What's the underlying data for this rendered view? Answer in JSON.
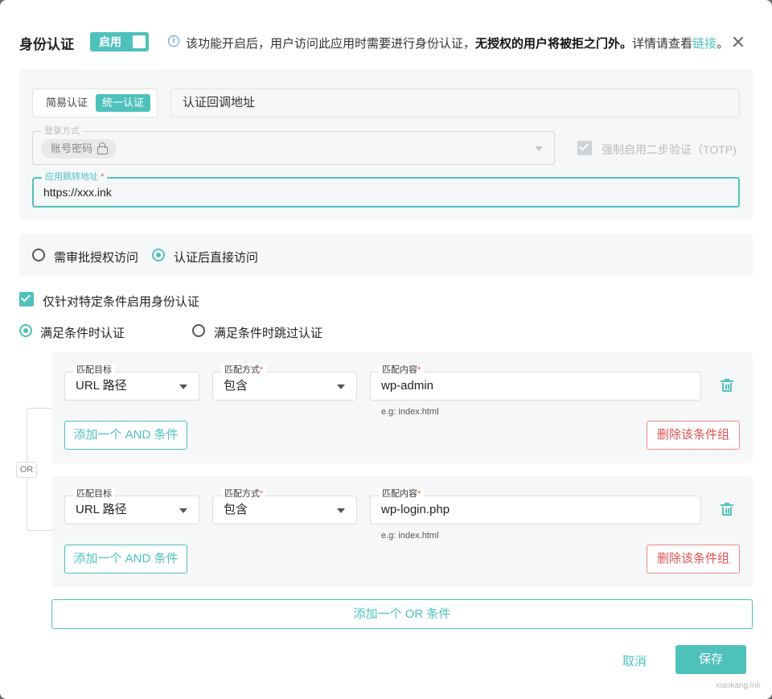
{
  "header": {
    "title": "身份认证",
    "toggle_label": "启用",
    "info_text": "该功能开启后，用户访问此应用时需要进行身份认证，",
    "info_bold": "无授权的用户将被拒之门外。",
    "info_suffix": "详情请查看",
    "info_link": "链接",
    "info_end": "。"
  },
  "auth_panel": {
    "mode_tabs": [
      {
        "label": "简易认证",
        "active": false
      },
      {
        "label": "统一认证",
        "active": true
      }
    ],
    "callback_url_label": "认证回调地址",
    "login_method_legend": "登录方式",
    "login_method_chip": "账号密码",
    "totp_label": "强制启用二步验证（TOTP)",
    "totp_checked": true,
    "redirect_legend": "应用跳转地址",
    "redirect_required": "*",
    "redirect_value": "https://xxx.ink"
  },
  "access": {
    "options": [
      "需审批授权访问",
      "认证后直接访问"
    ],
    "selected": "认证后直接访问"
  },
  "condition": {
    "checkbox_label": "仅针对特定条件启用身份认证",
    "checked": true,
    "modes": [
      "满足条件时认证",
      "满足条件时跳过认证"
    ],
    "selected_mode": "满足条件时认证",
    "or_label": "OR",
    "groups": [
      {
        "target_legend": "匹配目标",
        "target_value": "URL 路径",
        "method_legend": "匹配方式",
        "method_value": "包含",
        "content_legend": "匹配内容",
        "content_value": "wp-admin",
        "hint": "e.g: index.html",
        "add_and_label": "添加一个 AND 条件",
        "delete_group_label": "删除该条件组"
      },
      {
        "target_legend": "匹配目标",
        "target_value": "URL 路径",
        "method_legend": "匹配方式",
        "method_value": "包含",
        "content_legend": "匹配内容",
        "content_value": "wp-login.php",
        "hint": "e.g: index.html",
        "add_and_label": "添加一个 AND 条件",
        "delete_group_label": "删除该条件组"
      }
    ],
    "required_mark": "*",
    "add_or_label": "添加一个 OR 条件"
  },
  "footer": {
    "cancel_label": "取消",
    "save_label": "保存",
    "watermark": "xiaokang.ink"
  },
  "colors": {
    "accent": "#4fc1bb",
    "danger": "#e05252",
    "panel_bg": "#f6f7f8"
  }
}
